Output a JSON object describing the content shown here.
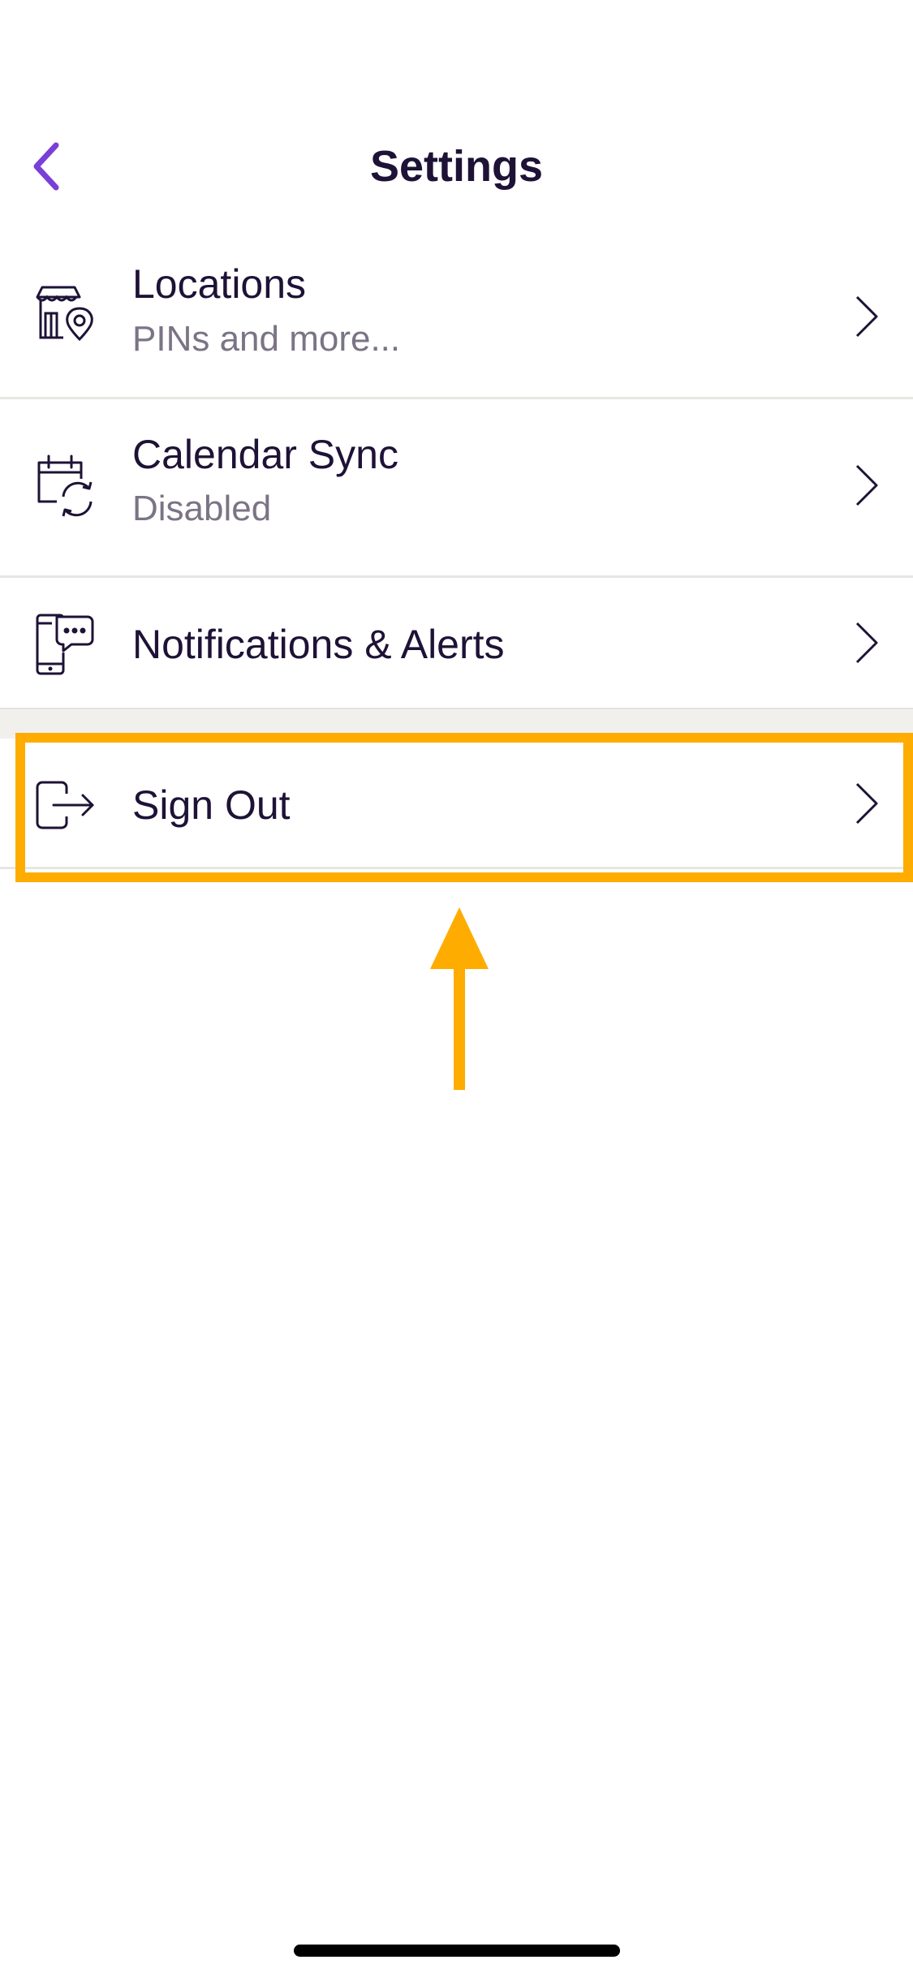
{
  "header": {
    "title": "Settings",
    "back_icon": "chevron-left-icon",
    "accent_color": "#7a3fd6"
  },
  "settings": {
    "items": [
      {
        "id": "locations",
        "icon": "location-storefront-icon",
        "title": "Locations",
        "subtitle": "PINs and more..."
      },
      {
        "id": "calendar-sync",
        "icon": "calendar-sync-icon",
        "title": "Calendar Sync",
        "subtitle": "Disabled"
      },
      {
        "id": "notifications",
        "icon": "phone-chat-icon",
        "title": "Notifications & Alerts"
      },
      {
        "id": "sign-out",
        "icon": "sign-out-icon",
        "title": "Sign Out"
      }
    ]
  },
  "annotation": {
    "highlight_color": "#ffac00",
    "target": "sign-out"
  }
}
